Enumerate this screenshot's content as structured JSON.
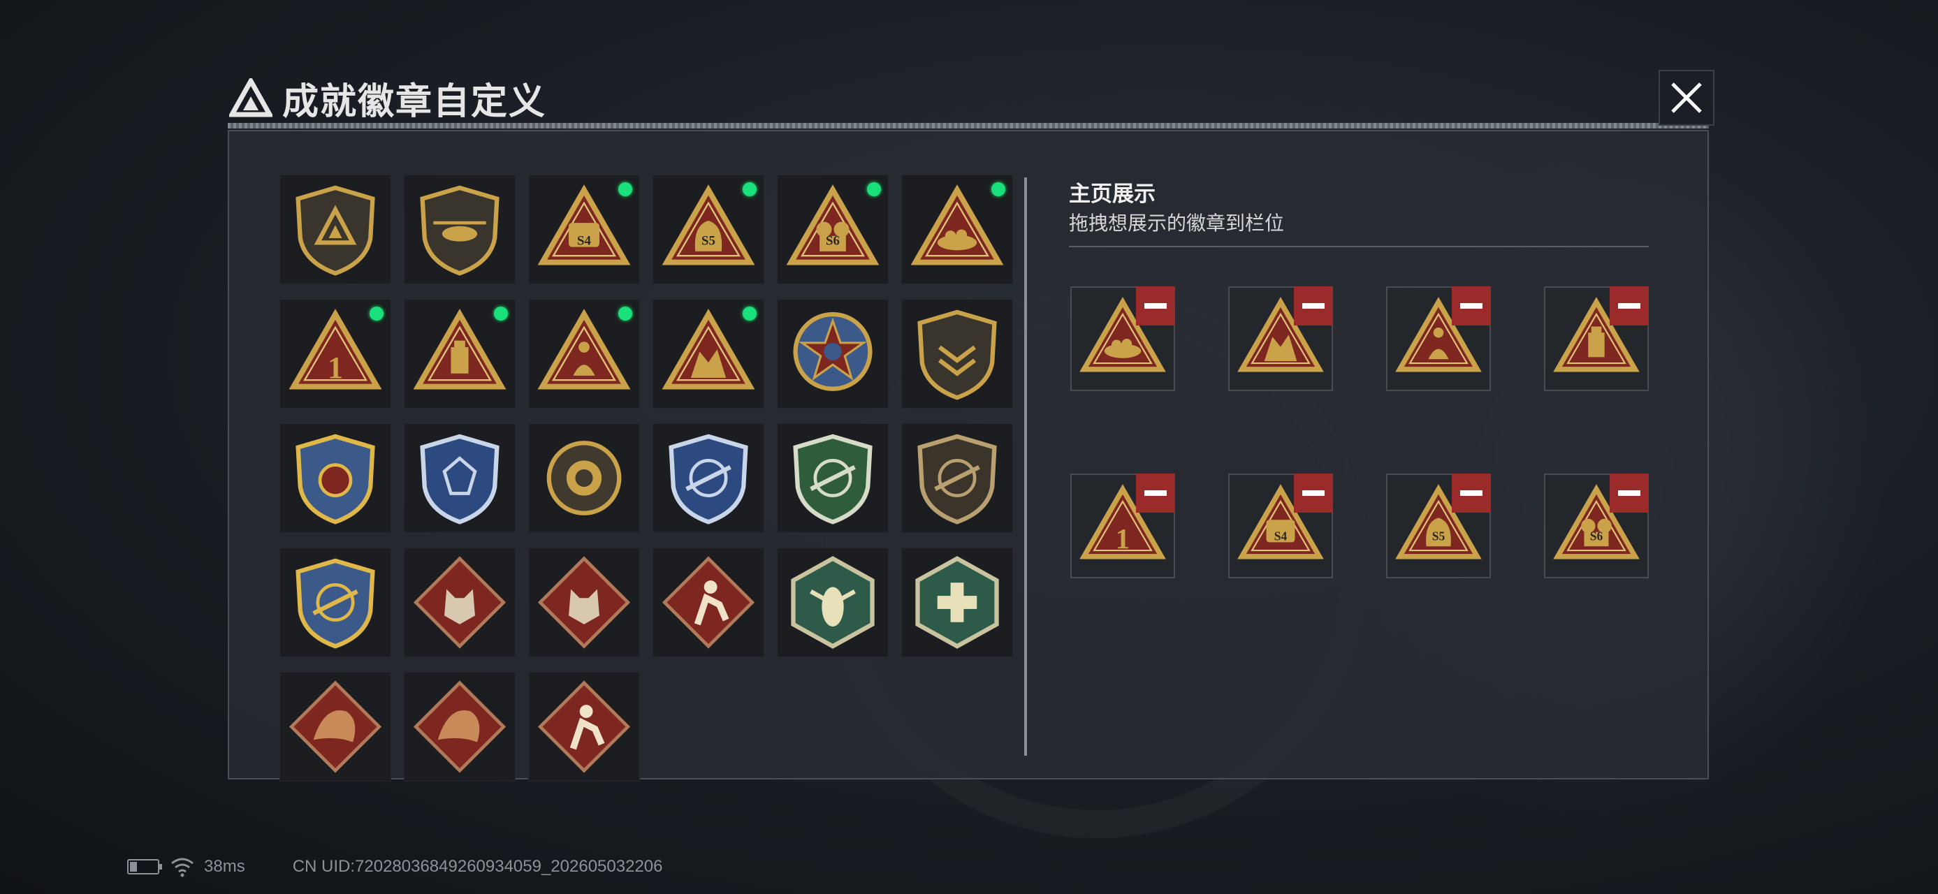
{
  "title": "成就徽章自定义",
  "showcase": {
    "heading": "主页展示",
    "subheading": "拖拽想展示的徽章到栏位",
    "slots": [
      {
        "badge": "triangle-nest-badge"
      },
      {
        "badge": "triangle-figures-badge"
      },
      {
        "badge": "triangle-crouching-badge"
      },
      {
        "badge": "triangle-usb-badge"
      },
      {
        "badge": "triangle-rank-1-badge",
        "text": "1"
      },
      {
        "badge": "triangle-s4-badge",
        "text": "S4"
      },
      {
        "badge": "triangle-s5-badge",
        "text": "S5"
      },
      {
        "badge": "triangle-s6-badge",
        "text": "S6"
      }
    ]
  },
  "collection": [
    {
      "badge": "shield-delta-badge",
      "equipped": false
    },
    {
      "badge": "shield-helicopter-badge",
      "equipped": false
    },
    {
      "badge": "triangle-s4-badge",
      "text": "S4",
      "equipped": true
    },
    {
      "badge": "triangle-s5-badge",
      "text": "S5",
      "equipped": true
    },
    {
      "badge": "triangle-s6-badge",
      "text": "S6",
      "equipped": true
    },
    {
      "badge": "triangle-nest-badge",
      "equipped": true
    },
    {
      "badge": "triangle-rank-1-badge",
      "text": "1",
      "equipped": true
    },
    {
      "badge": "triangle-usb-badge",
      "equipped": true
    },
    {
      "badge": "triangle-crouching-badge",
      "equipped": true
    },
    {
      "badge": "triangle-figures-badge",
      "equipped": true
    },
    {
      "badge": "star-medal-badge",
      "equipped": false
    },
    {
      "badge": "shield-chevron-badge",
      "equipped": false
    },
    {
      "badge": "gold-shield-stars-badge",
      "equipped": false
    },
    {
      "badge": "blue-shield-diamond-badge",
      "equipped": false
    },
    {
      "badge": "round-armor-badge",
      "equipped": false
    },
    {
      "badge": "blue-crosshair-rifle-badge",
      "equipped": false
    },
    {
      "badge": "green-crosshair-rifle-badge",
      "equipped": false
    },
    {
      "badge": "dark-shield-crosshair-badge",
      "equipped": false
    },
    {
      "badge": "gold-crosshair-wreath-badge",
      "equipped": false
    },
    {
      "badge": "diamond-wolf-badge",
      "equipped": false
    },
    {
      "badge": "diamond-wolf-2-badge",
      "equipped": false
    },
    {
      "badge": "diamond-runner-badge",
      "equipped": false
    },
    {
      "badge": "hex-hornet-badge",
      "equipped": false
    },
    {
      "badge": "hex-medic-badge",
      "equipped": false
    },
    {
      "badge": "diamond-dragon-badge",
      "equipped": false
    },
    {
      "badge": "diamond-dragon-2-badge",
      "equipped": false
    },
    {
      "badge": "diamond-runner-2-badge",
      "equipped": false
    }
  ],
  "status_bar": {
    "ping": "38ms",
    "uid": "CN UID:72028036849260934059_202605032206"
  },
  "colors": {
    "equipped_dot": "#19e07a",
    "remove_button": "#9b2a2a",
    "badge_gold": "#c9a24a",
    "badge_red": "#8a2a24"
  }
}
